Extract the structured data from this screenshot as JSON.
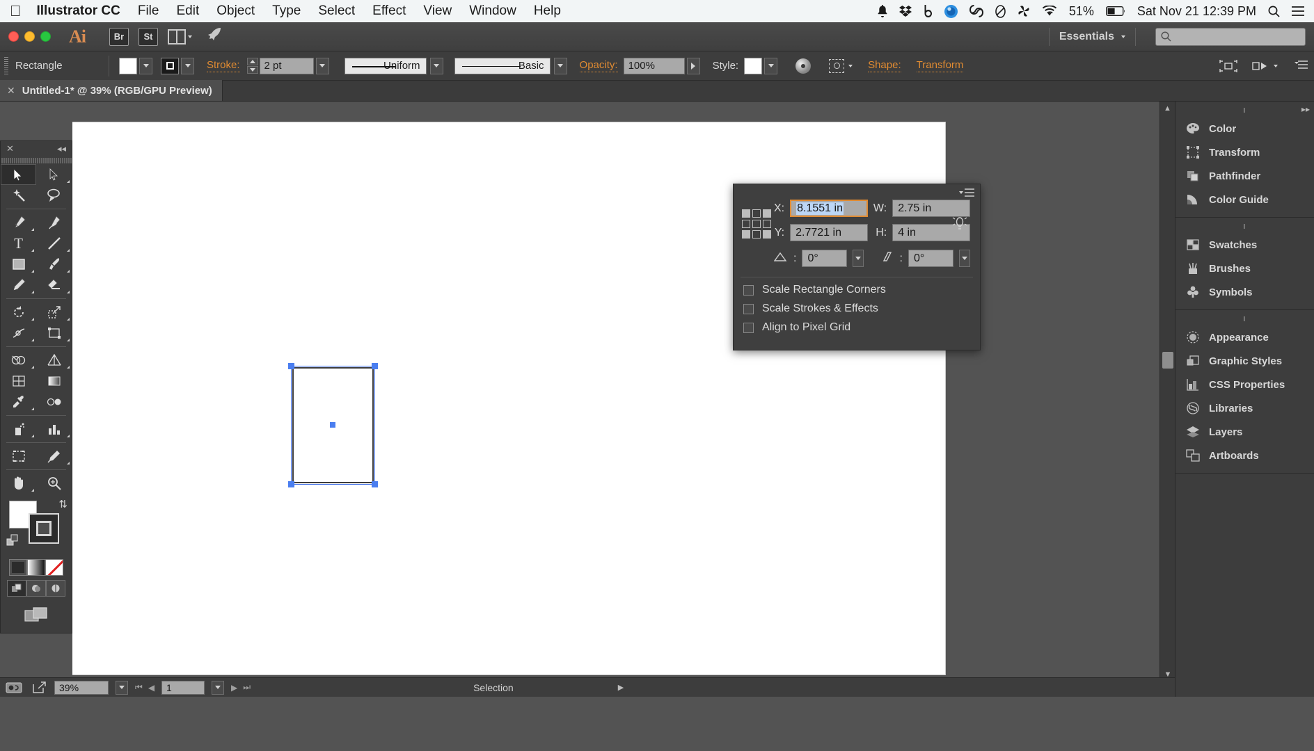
{
  "menubar": {
    "apple": "apple-logo",
    "app_name": "Illustrator CC",
    "items": [
      "File",
      "Edit",
      "Object",
      "Type",
      "Select",
      "Effect",
      "View",
      "Window",
      "Help"
    ],
    "tray": [
      {
        "name": "notification-bell-icon"
      },
      {
        "name": "dropbox-icon"
      },
      {
        "name": "backblaze-icon"
      },
      {
        "name": "blue-orb-icon"
      },
      {
        "name": "creative-cloud-icon"
      },
      {
        "name": "oval-icon"
      },
      {
        "name": "pinwheel-icon"
      },
      {
        "name": "wifi-icon"
      }
    ],
    "battery_percent": "51%",
    "datetime": "Sat Nov 21  12:39 PM",
    "search_icon": "search-icon",
    "menu_list_icon": "control-center-icon"
  },
  "titlebar": {
    "app_icon": "Ai",
    "bridge_label": "Br",
    "stock_label": "St",
    "arrange_icon": "arrange-documents-icon",
    "rocket_icon": "rocket-icon",
    "workspace": "Essentials",
    "search_placeholder": "",
    "search_value": ""
  },
  "controlbar": {
    "object_type": "Rectangle",
    "fill_swatch": "white",
    "stroke_swatch": "stroke-box",
    "stroke_label": "Stroke:",
    "stroke_weight": "2 pt",
    "profile": "Uniform",
    "brush": "Basic",
    "opacity_label": "Opacity:",
    "opacity_value": "100%",
    "style_label": "Style:",
    "shape_label": "Shape:",
    "transform_label": "Transform",
    "recolor_icon": "recolor-artwork-icon",
    "isolate_icon": "isolate-selected-icon",
    "align_icon": "align-icon",
    "distribute_icon": "distribute-icon",
    "panel_options_icon": "panel-options-icon"
  },
  "document_tab": {
    "close_icon": "close-icon",
    "title": "Untitled-1* @ 39% (RGB/GPU Preview)"
  },
  "toolbar": {
    "close_icon": "close-icon",
    "collapse_icon": "collapse-panel-icon",
    "tools": [
      {
        "name": "selection-tool",
        "glyph": "arrow",
        "active": true,
        "corner": false
      },
      {
        "name": "direct-selection-tool",
        "glyph": "arrow-white",
        "active": false,
        "corner": true
      },
      {
        "name": "magic-wand-tool",
        "glyph": "wand",
        "active": false,
        "corner": false
      },
      {
        "name": "lasso-tool",
        "glyph": "lasso",
        "active": false,
        "corner": false
      },
      {
        "name": "pen-tool",
        "glyph": "pen",
        "active": false,
        "corner": true
      },
      {
        "name": "curvature-tool",
        "glyph": "curvature",
        "active": false,
        "corner": false
      },
      {
        "name": "type-tool",
        "glyph": "T",
        "active": false,
        "corner": true
      },
      {
        "name": "line-segment-tool",
        "glyph": "line",
        "active": false,
        "corner": true
      },
      {
        "name": "rectangle-tool",
        "glyph": "rect",
        "active": false,
        "corner": true
      },
      {
        "name": "paintbrush-tool",
        "glyph": "brush",
        "active": false,
        "corner": true
      },
      {
        "name": "pencil-tool",
        "glyph": "pencil",
        "active": false,
        "corner": true
      },
      {
        "name": "eraser-tool",
        "glyph": "eraser",
        "active": false,
        "corner": true
      },
      {
        "name": "rotate-tool",
        "glyph": "rotate",
        "active": false,
        "corner": true
      },
      {
        "name": "scale-tool",
        "glyph": "scale",
        "active": false,
        "corner": true
      },
      {
        "name": "width-tool",
        "glyph": "width",
        "active": false,
        "corner": true
      },
      {
        "name": "free-transform-tool",
        "glyph": "freetransform",
        "active": false,
        "corner": true
      },
      {
        "name": "shape-builder-tool",
        "glyph": "shapebuilder",
        "active": false,
        "corner": true
      },
      {
        "name": "perspective-grid-tool",
        "glyph": "perspective",
        "active": false,
        "corner": true
      },
      {
        "name": "mesh-tool",
        "glyph": "mesh",
        "active": false,
        "corner": false
      },
      {
        "name": "gradient-tool",
        "glyph": "gradient",
        "active": false,
        "corner": false
      },
      {
        "name": "eyedropper-tool",
        "glyph": "eyedropper",
        "active": false,
        "corner": true
      },
      {
        "name": "blend-tool",
        "glyph": "blend",
        "active": false,
        "corner": false
      },
      {
        "name": "symbol-sprayer-tool",
        "glyph": "sprayer",
        "active": false,
        "corner": true
      },
      {
        "name": "column-graph-tool",
        "glyph": "graph",
        "active": false,
        "corner": true
      },
      {
        "name": "artboard-tool",
        "glyph": "artboard",
        "active": false,
        "corner": false
      },
      {
        "name": "slice-tool",
        "glyph": "slice",
        "active": false,
        "corner": true
      },
      {
        "name": "hand-tool",
        "glyph": "hand",
        "active": false,
        "corner": true
      },
      {
        "name": "zoom-tool",
        "glyph": "zoom",
        "active": false,
        "corner": false
      }
    ],
    "fill_color": "#ffffff",
    "stroke_color": "#2b2b2b",
    "swap_icon": "swap-fill-stroke-icon",
    "default_icon": "default-fill-stroke-icon",
    "color_modes": [
      {
        "name": "color-mode-button",
        "active": true
      },
      {
        "name": "gradient-mode-button",
        "active": false
      },
      {
        "name": "none-mode-button",
        "active": false
      }
    ],
    "draw_modes": [
      {
        "name": "draw-normal-button",
        "active": true
      },
      {
        "name": "draw-behind-button",
        "active": false
      },
      {
        "name": "draw-inside-button",
        "active": false
      }
    ],
    "screen_mode_icon": "change-screen-mode-icon"
  },
  "transform_panel": {
    "menu_icon": "panel-flyout-menu-icon",
    "reference_point_icon": "reference-point-selector",
    "fields": [
      {
        "label": "X:",
        "value": "8.1551 in",
        "name": "x-field",
        "focused": true
      },
      {
        "label": "W:",
        "value": "2.75 in",
        "name": "width-field",
        "focused": false
      },
      {
        "label": "Y:",
        "value": "2.7721 in",
        "name": "y-field",
        "focused": false
      },
      {
        "label": "H:",
        "value": "4 in",
        "name": "height-field",
        "focused": false
      }
    ],
    "rotate_label": "rotate-angle-icon",
    "rotate_value": "0°",
    "shear_label": "shear-angle-icon",
    "shear_value": "0°",
    "constrain_icon": "constrain-proportions-icon",
    "checkboxes": [
      {
        "label": "Scale Rectangle Corners",
        "checked": false,
        "name": "scale-rectangle-corners-checkbox"
      },
      {
        "label": "Scale Strokes & Effects",
        "checked": false,
        "name": "scale-strokes-effects-checkbox"
      },
      {
        "label": "Align to Pixel Grid",
        "checked": false,
        "name": "align-to-pixel-grid-checkbox"
      }
    ]
  },
  "dock": {
    "collapse_icon": "collapse-dock-icon",
    "groups": [
      {
        "items": [
          {
            "label": "Color",
            "icon": "color-palette-icon"
          },
          {
            "label": "Transform",
            "icon": "transform-icon"
          },
          {
            "label": "Pathfinder",
            "icon": "pathfinder-icon"
          },
          {
            "label": "Color Guide",
            "icon": "color-guide-icon"
          }
        ]
      },
      {
        "items": [
          {
            "label": "Swatches",
            "icon": "swatches-icon"
          },
          {
            "label": "Brushes",
            "icon": "brushes-icon"
          },
          {
            "label": "Symbols",
            "icon": "symbols-icon"
          }
        ]
      },
      {
        "items": [
          {
            "label": "Appearance",
            "icon": "appearance-icon"
          },
          {
            "label": "Graphic Styles",
            "icon": "graphic-styles-icon"
          },
          {
            "label": "CSS Properties",
            "icon": "css-properties-icon"
          },
          {
            "label": "Libraries",
            "icon": "libraries-icon"
          },
          {
            "label": "Layers",
            "icon": "layers-icon"
          },
          {
            "label": "Artboards",
            "icon": "artboards-icon"
          }
        ]
      }
    ]
  },
  "statusbar": {
    "preferences_icon": "preferences-icon",
    "share_icon": "share-icon",
    "zoom_value": "39%",
    "artboard_value": "1",
    "status_text": "Selection",
    "first_icon": "first-artboard-icon",
    "prev_icon": "previous-artboard-icon",
    "next_icon": "next-artboard-icon",
    "last_icon": "last-artboard-icon",
    "status_menu_icon": "status-menu-icon"
  },
  "canvas": {
    "shape_name": "selected-rectangle",
    "selection_color": "#4a7ef0"
  }
}
